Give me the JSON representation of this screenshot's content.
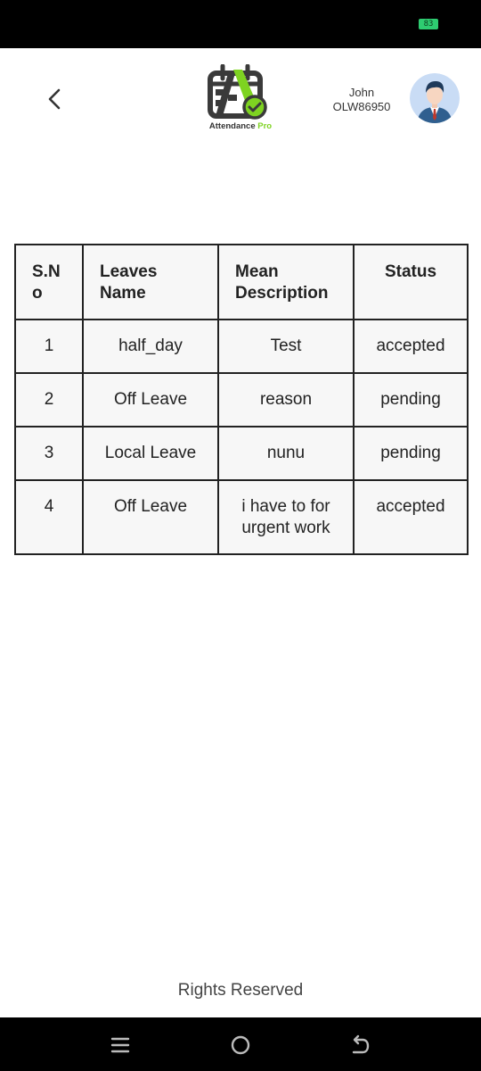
{
  "status_bar": {
    "battery_level": "83",
    "battery_color": "#2ecc71"
  },
  "header": {
    "back_icon": "chevron-left-icon",
    "logo": {
      "icon": "calendar-check-icon",
      "text_main": "Attendance ",
      "text_accent": "Pro",
      "accent_color": "#7ed321"
    },
    "user": {
      "name": "John",
      "id": "OLW86950",
      "avatar_icon": "user-avatar-icon"
    }
  },
  "leaves_table": {
    "columns": [
      "S.N o",
      "Leaves Name",
      "Mean Description",
      "Status"
    ],
    "rows": [
      {
        "sno": "1",
        "name": "half_day",
        "description": "Test",
        "status": "accepted"
      },
      {
        "sno": "2",
        "name": "Off Leave",
        "description": "reason",
        "status": "pending"
      },
      {
        "sno": "3",
        "name": "Local Leave",
        "description": "nunu",
        "status": "pending"
      },
      {
        "sno": "4",
        "name": "Off Leave",
        "description": "i have to for urgent work",
        "status": "accepted"
      }
    ]
  },
  "footer": {
    "text": "Rights Reserved"
  },
  "nav_bar": {
    "menu_icon": "menu-icon",
    "home_icon": "home-circle-icon",
    "back_icon": "back-arrow-icon"
  }
}
